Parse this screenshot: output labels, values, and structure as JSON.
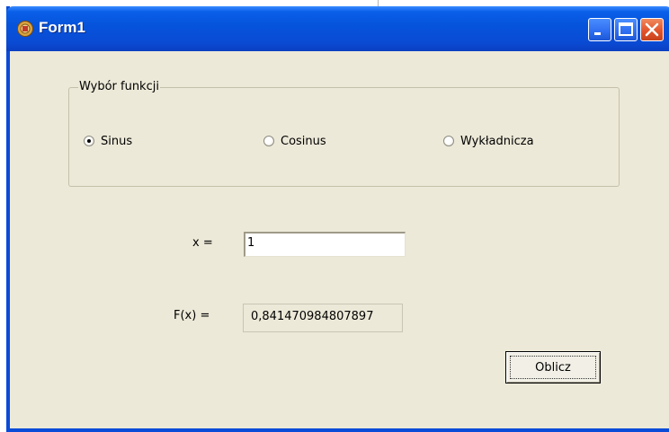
{
  "window": {
    "title": "Form1"
  },
  "group": {
    "label": "Wybór funkcji",
    "options": [
      {
        "label": "Sinus",
        "selected": true
      },
      {
        "label": "Cosinus",
        "selected": false
      },
      {
        "label": "Wykładnicza",
        "selected": false
      }
    ]
  },
  "form": {
    "x_label": "x =",
    "x_value": "1",
    "fx_label": "F(x) =",
    "fx_value": "0,841470984807897"
  },
  "button": {
    "compute_label": "Oblicz"
  },
  "colors": {
    "titlebar": "#0a5fe9",
    "window_bg": "#ece9d8",
    "close_button": "#e2542b"
  },
  "icons": {
    "app": "form-app-icon",
    "minimize": "minimize-icon",
    "maximize": "maximize-icon",
    "close": "close-icon"
  }
}
